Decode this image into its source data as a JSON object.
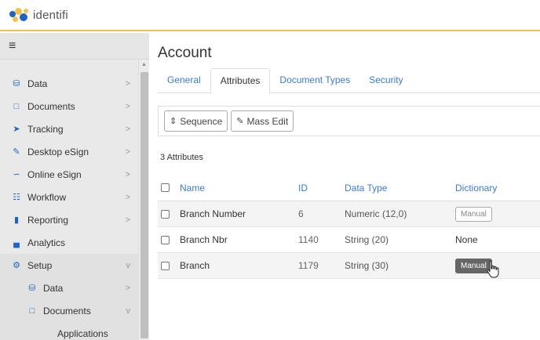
{
  "app": {
    "logo_text": "identifi"
  },
  "sidebar": {
    "items": [
      {
        "label": "Data",
        "icon": "database-icon",
        "icon_color": "#1e63c5",
        "chevron": ">"
      },
      {
        "label": "Documents",
        "icon": "document-icon",
        "icon_color": "#1e63c5",
        "chevron": ">"
      },
      {
        "label": "Tracking",
        "icon": "send-icon",
        "icon_color": "#1e63c5",
        "chevron": ">"
      },
      {
        "label": "Desktop eSign",
        "icon": "pen-icon",
        "icon_color": "#1e63c5",
        "chevron": ">"
      },
      {
        "label": "Online eSign",
        "icon": "signature-icon",
        "icon_color": "#1e63c5",
        "chevron": ">"
      },
      {
        "label": "Workflow",
        "icon": "workflow-icon",
        "icon_color": "#1e63c5",
        "chevron": ">"
      },
      {
        "label": "Reporting",
        "icon": "report-icon",
        "icon_color": "#1e63c5",
        "chevron": ">"
      },
      {
        "label": "Analytics",
        "icon": "chart-icon",
        "icon_color": "#1e63c5",
        "chevron": ""
      },
      {
        "label": "Setup",
        "icon": "gear-icon",
        "icon_color": "#1e63c5",
        "chevron": "v"
      }
    ],
    "sub_items": [
      {
        "label": "Data",
        "icon": "database-icon",
        "chevron": ">"
      },
      {
        "label": "Documents",
        "icon": "document-icon",
        "chevron": "v"
      }
    ],
    "subsub_items": [
      {
        "label": "Applications"
      }
    ]
  },
  "main": {
    "title": "Account",
    "tabs": [
      {
        "label": "General",
        "active": false
      },
      {
        "label": "Attributes",
        "active": true
      },
      {
        "label": "Document Types",
        "active": false
      },
      {
        "label": "Security",
        "active": false
      }
    ],
    "toolbar": {
      "sequence_label": "Sequence",
      "mass_edit_label": "Mass Edit"
    },
    "count_label": "3 Attributes",
    "columns": {
      "name": "Name",
      "id": "ID",
      "data_type": "Data Type",
      "dictionary": "Dictionary"
    },
    "rows": [
      {
        "name": "Branch Number",
        "id": "6",
        "data_type": "Numeric (12,0)",
        "dictionary": "Manual",
        "dictionary_kind": "button"
      },
      {
        "name": "Branch Nbr",
        "id": "1140",
        "data_type": "String (20)",
        "dictionary": "None",
        "dictionary_kind": "text"
      },
      {
        "name": "Branch",
        "id": "1179",
        "data_type": "String (30)",
        "dictionary": "Manual",
        "dictionary_kind": "button-hover"
      }
    ]
  },
  "colors": {
    "accent": "#3a7bd5",
    "brand_blue": "#1e63c5",
    "topbar_border": "#f2c14e"
  }
}
